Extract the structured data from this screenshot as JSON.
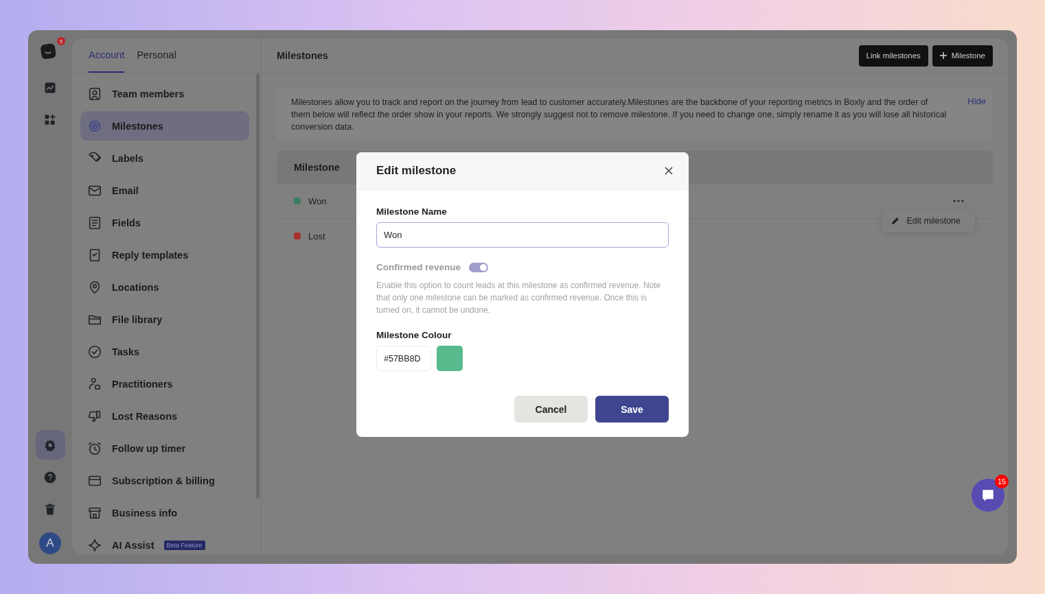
{
  "rail": {
    "logo_badge": "5",
    "top_items": [
      {
        "kind": "chart",
        "selected": false
      },
      {
        "kind": "apps",
        "selected": false
      }
    ],
    "bottom_items": [
      {
        "kind": "settings",
        "selected": true
      },
      {
        "kind": "help",
        "selected": false
      },
      {
        "kind": "trash",
        "selected": false
      }
    ],
    "avatar": "A"
  },
  "tabs": [
    {
      "label": "Account",
      "selected": true
    },
    {
      "label": "Personal",
      "selected": false
    }
  ],
  "sidebar": {
    "items": [
      {
        "label": "Team members",
        "kind": "person",
        "selected": false
      },
      {
        "label": "Milestones",
        "kind": "target",
        "selected": true
      },
      {
        "label": "Labels",
        "kind": "tag",
        "selected": false
      },
      {
        "label": "Email",
        "kind": "mail",
        "selected": false
      },
      {
        "label": "Fields",
        "kind": "doc",
        "selected": false
      },
      {
        "label": "Reply templates",
        "kind": "bookmark",
        "selected": false
      },
      {
        "label": "Locations",
        "kind": "pin",
        "selected": false
      },
      {
        "label": "File library",
        "kind": "folder",
        "selected": false
      },
      {
        "label": "Tasks",
        "kind": "check",
        "selected": false
      },
      {
        "label": "Practitioners",
        "kind": "users",
        "selected": false
      },
      {
        "label": "Lost Reasons",
        "kind": "thumb",
        "selected": false
      },
      {
        "label": "Follow up timer",
        "kind": "alarm",
        "selected": false
      },
      {
        "label": "Subscription & billing",
        "kind": "card",
        "selected": false
      },
      {
        "label": "Business info",
        "kind": "store",
        "selected": false
      },
      {
        "label": "AI Assist",
        "kind": "sparkle",
        "selected": false,
        "badge": "Beta Feature"
      }
    ]
  },
  "main": {
    "title": "Milestones",
    "buttons": [
      {
        "label": "Link milestones",
        "kind": "plain"
      },
      {
        "label": "Milestone",
        "kind": "add"
      }
    ],
    "notice": {
      "text": "Milestones allow you to track and report on the journey from lead to customer accurately.Milestones are the backbone of your reporting metrics in Boxly and the order of them below will reflect the order show in your reports. We strongly suggest not to remove milestone. If you need to change one, simply rename it as you will lose all historical conversion data.",
      "action": "Hide"
    },
    "table": {
      "column": "Milestone",
      "rows": [
        {
          "name": "Won",
          "color": "#3a7d5e"
        },
        {
          "name": "Lost",
          "color": "#a8302c"
        }
      ]
    },
    "row_menu": {
      "items": [
        {
          "label": "Edit milestone",
          "kind": "edit"
        }
      ]
    }
  },
  "modal": {
    "title": "Edit milestone",
    "name_label": "Milestone Name",
    "name_value": "Won",
    "revenue_label": "Confirmed revenue",
    "revenue_on": true,
    "revenue_help": "Enable this option to count leads at this milestone as confirmed revenue. Note that only one milestone can be marked as confirmed revenue. Once this is turned on, it cannot be undone.",
    "colour_label": "Milestone Colour",
    "colour_value": "#57BB8D",
    "buttons": [
      {
        "label": "Cancel",
        "kind": "secondary"
      },
      {
        "label": "Save",
        "kind": "primary"
      }
    ]
  },
  "chat": {
    "badge": "15"
  }
}
